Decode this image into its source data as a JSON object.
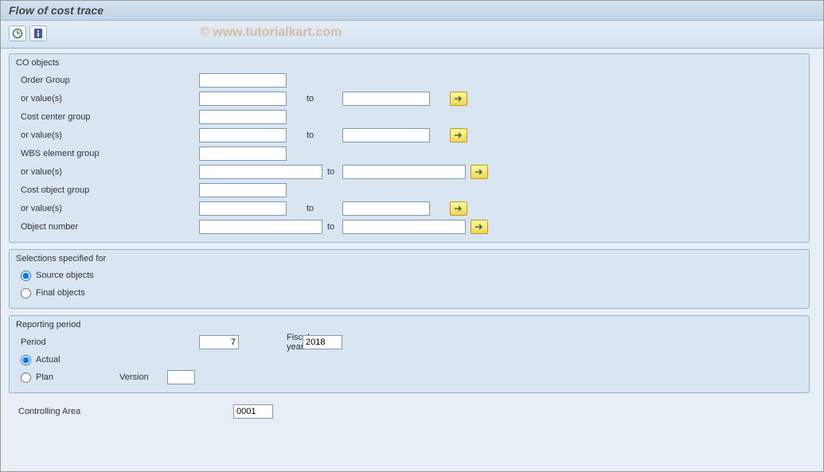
{
  "title": "Flow of cost trace",
  "watermark": "© www.tutorialkart.com",
  "groups": {
    "co_objects": {
      "title": "CO objects",
      "order_group": "Order Group",
      "or_values": "or value(s)",
      "cost_center_group": "Cost center group",
      "wbs_group": "WBS element group",
      "cost_object_group": "Cost object group",
      "object_number": "Object number",
      "to": "to"
    },
    "selections": {
      "title": "Selections specified for",
      "source": "Source objects",
      "final": "Final objects"
    },
    "reporting": {
      "title": "Reporting period",
      "period_label": "Period",
      "period_value": "7",
      "fiscal_label": "Fiscal year",
      "fiscal_value": "2018",
      "actual": "Actual",
      "plan": "Plan",
      "version_label": "Version",
      "version_value": ""
    }
  },
  "controlling_area": {
    "label": "Controlling Area",
    "value": "0001"
  }
}
